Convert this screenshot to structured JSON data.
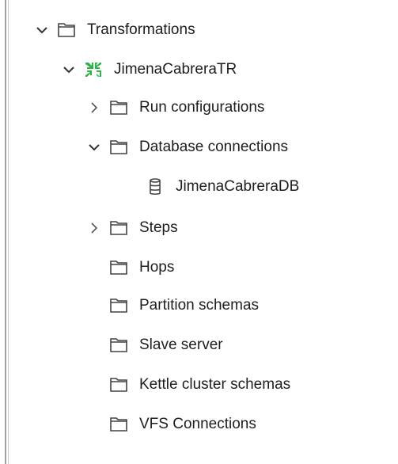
{
  "tree": {
    "transformations": {
      "label": "Transformations"
    },
    "jimena_tr": {
      "label": "JimenaCabreraTR"
    },
    "run_configurations": {
      "label": "Run configurations"
    },
    "database_connections": {
      "label": "Database connections"
    },
    "jimena_db": {
      "label": "JimenaCabreraDB"
    },
    "steps": {
      "label": "Steps"
    },
    "hops": {
      "label": "Hops"
    },
    "partition_schemas": {
      "label": "Partition schemas"
    },
    "slave_server": {
      "label": "Slave server"
    },
    "kettle_cluster_schemas": {
      "label": "Kettle cluster schemas"
    },
    "vfs_connections": {
      "label": "VFS Connections"
    }
  },
  "colors": {
    "folder_stroke": "#444444",
    "transformation_icon": "#2db34a",
    "text": "#1e1e1e",
    "chevron": "#333333"
  }
}
